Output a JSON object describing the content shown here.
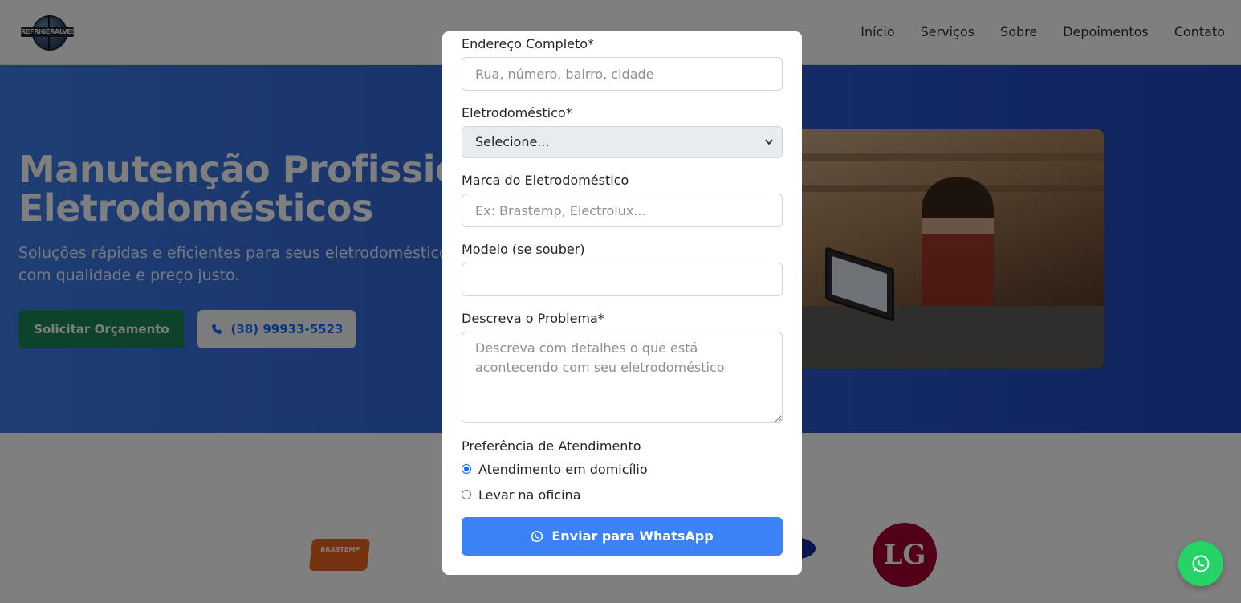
{
  "nav": {
    "logo_text": "REFRIGERALVES",
    "links": [
      "Início",
      "Serviços",
      "Sobre",
      "Depoimentos",
      "Contato"
    ]
  },
  "hero": {
    "title_line1": "Manutenção Profissional",
    "title_line2": "Eletrodomésticos",
    "subtitle": "Soluções rápidas e eficientes para seus eletrodomésticos com qualidade e preço justo.",
    "quote_button": "Solicitar Orçamento",
    "phone_button": "(38) 99933-5523"
  },
  "brands": {
    "brastemp": "BRASTEMP",
    "lg": "LG"
  },
  "modal": {
    "address_label": "Endereço Completo*",
    "address_placeholder": "Rua, número, bairro, cidade",
    "appliance_label": "Eletrodoméstico*",
    "appliance_selected": "Selecione...",
    "brand_label": "Marca do Eletrodoméstico",
    "brand_placeholder": "Ex: Brastemp, Electrolux...",
    "model_label": "Modelo (se souber)",
    "model_value": "",
    "problem_label": "Descreva o Problema*",
    "problem_placeholder": "Descreva com detalhes o que está acontecendo com seu eletrodoméstico",
    "preference_label": "Preferência de Atendimento",
    "options": [
      {
        "label": "Atendimento em domicílio",
        "checked": true
      },
      {
        "label": "Levar na oficina",
        "checked": false
      }
    ],
    "submit_label": "Enviar para WhatsApp"
  },
  "colors": {
    "primary": "#0d6efd",
    "success": "#198754",
    "whatsapp": "#25d366",
    "submit": "#3b82f6"
  }
}
